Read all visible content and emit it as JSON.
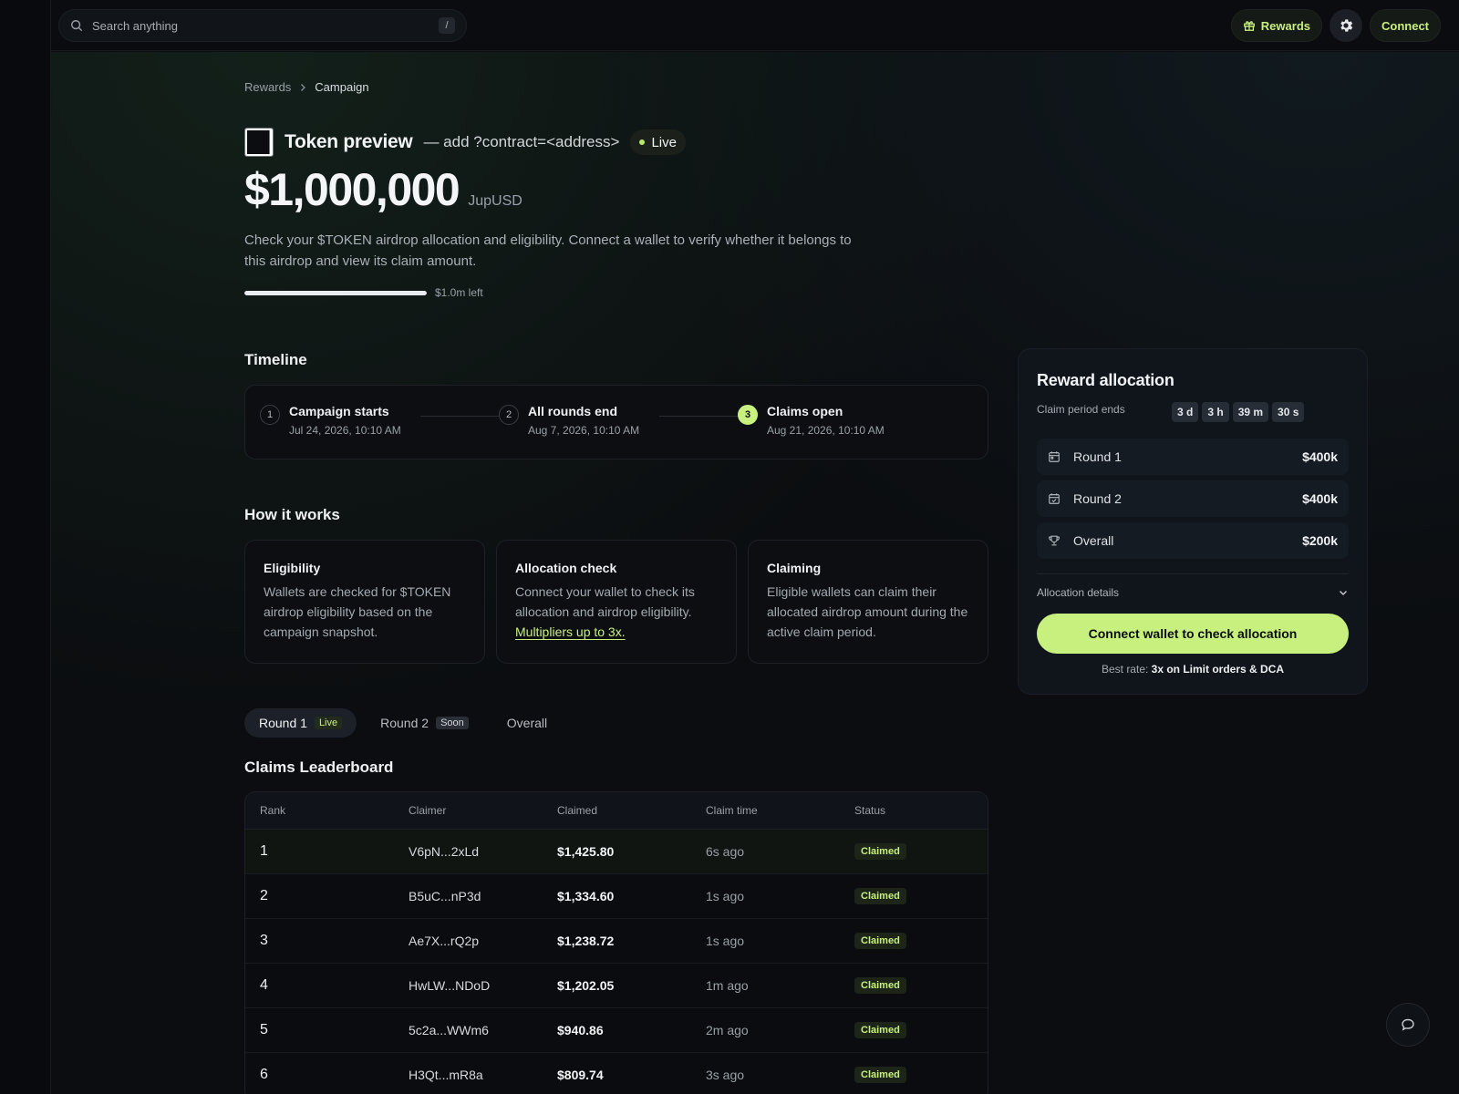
{
  "topbar": {
    "search_placeholder": "Search anything",
    "search_shortcut": "/",
    "rewards_label": "Rewards",
    "connect_label": "Connect"
  },
  "breadcrumb": {
    "parent": "Rewards",
    "current": "Campaign"
  },
  "token": {
    "name": "Token preview",
    "subtitle": "— add ?contract=<address>",
    "status": "Live",
    "amount": "$1,000,000",
    "unit": "JupUSD",
    "description": "Check your $TOKEN airdrop allocation and eligibility. Connect a wallet to verify whether it belongs to this airdrop and view its claim amount.",
    "progress_remaining_fraction": 1.0,
    "progress_label": "$1.0m left"
  },
  "timeline": {
    "title": "Timeline",
    "steps": [
      {
        "num": "1",
        "title": "Campaign starts",
        "date": "Jul 24, 2026, 10:10 AM"
      },
      {
        "num": "2",
        "title": "All rounds end",
        "date": "Aug 7, 2026, 10:10 AM"
      },
      {
        "num": "3",
        "title": "Claims open",
        "date": "Aug 21, 2026, 10:10 AM"
      }
    ]
  },
  "how_it_works": {
    "title": "How it works",
    "cards": [
      {
        "title": "Eligibility",
        "text": "Wallets are checked for $TOKEN airdrop eligibility based on the campaign snapshot."
      },
      {
        "title": "Allocation check",
        "text": "Connect your wallet to check its allocation and airdrop eligibility.",
        "link": "Multipliers up to 3x."
      },
      {
        "title": "Claiming",
        "text": "Eligible wallets can claim their allocated airdrop amount during the active claim period."
      }
    ]
  },
  "tabs": [
    {
      "label": "Round 1",
      "badge": "Live"
    },
    {
      "label": "Round 2",
      "badge": "Soon"
    },
    {
      "label": "Overall"
    }
  ],
  "leaderboard": {
    "title": "Claims Leaderboard",
    "columns": [
      "Rank",
      "Claimer",
      "Claimed",
      "Claim time",
      "Status"
    ],
    "rows": [
      {
        "rank": "1",
        "claimer": "V6pN...2xLd",
        "claimed": "$1,425.80",
        "time": "6s ago",
        "status": "Claimed"
      },
      {
        "rank": "2",
        "claimer": "B5uC...nP3d",
        "claimed": "$1,334.60",
        "time": "1s ago",
        "status": "Claimed"
      },
      {
        "rank": "3",
        "claimer": "Ae7X...rQ2p",
        "claimed": "$1,238.72",
        "time": "1s ago",
        "status": "Claimed"
      },
      {
        "rank": "4",
        "claimer": "HwLW...NDoD",
        "claimed": "$1,202.05",
        "time": "1m ago",
        "status": "Claimed"
      },
      {
        "rank": "5",
        "claimer": "5c2a...WWm6",
        "claimed": "$940.86",
        "time": "2m ago",
        "status": "Claimed"
      },
      {
        "rank": "6",
        "claimer": "H3Qt...mR8a",
        "claimed": "$809.74",
        "time": "3s ago",
        "status": "Claimed"
      }
    ]
  },
  "reward_allocation": {
    "title": "Reward allocation",
    "claim_period_label": "Claim period ends",
    "countdown": [
      "3 d",
      "3 h",
      "39 m",
      "30 s"
    ],
    "rows": [
      {
        "label": "Round 1",
        "value": "$400k",
        "icon": "calendar-icon"
      },
      {
        "label": "Round 2",
        "value": "$400k",
        "icon": "calendar-check-icon"
      },
      {
        "label": "Overall",
        "value": "$200k",
        "icon": "trophy-icon"
      }
    ],
    "details_label": "Allocation details",
    "cta_label": "Connect wallet to check allocation",
    "best_rate_prefix": "Best rate:",
    "best_rate_value": "3x on Limit orders & DCA"
  },
  "colors": {
    "accent": "#c8f07e",
    "background": "#0b0d10",
    "card": "#10151c"
  }
}
